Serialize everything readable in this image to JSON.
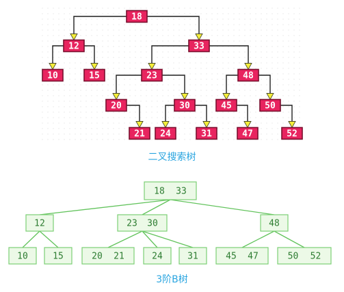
{
  "bst": {
    "caption": "二叉搜索树",
    "nodes": [
      {
        "id": "n18",
        "label": "18"
      },
      {
        "id": "n12",
        "label": "12"
      },
      {
        "id": "n33",
        "label": "33"
      },
      {
        "id": "n10",
        "label": "10"
      },
      {
        "id": "n15",
        "label": "15"
      },
      {
        "id": "n23",
        "label": "23"
      },
      {
        "id": "n48",
        "label": "48"
      },
      {
        "id": "n20",
        "label": "20"
      },
      {
        "id": "n30",
        "label": "30"
      },
      {
        "id": "n45",
        "label": "45"
      },
      {
        "id": "n50",
        "label": "50"
      },
      {
        "id": "n21",
        "label": "21"
      },
      {
        "id": "n24",
        "label": "24"
      },
      {
        "id": "n31",
        "label": "31"
      },
      {
        "id": "n47",
        "label": "47"
      },
      {
        "id": "n52",
        "label": "52"
      }
    ],
    "edges": [
      [
        "n18",
        "n12"
      ],
      [
        "n18",
        "n33"
      ],
      [
        "n12",
        "n10"
      ],
      [
        "n12",
        "n15"
      ],
      [
        "n33",
        "n23"
      ],
      [
        "n33",
        "n48"
      ],
      [
        "n23",
        "n20"
      ],
      [
        "n23",
        "n30"
      ],
      [
        "n48",
        "n45"
      ],
      [
        "n48",
        "n50"
      ],
      [
        "n20",
        "n21"
      ],
      [
        "n30",
        "n24"
      ],
      [
        "n30",
        "n31"
      ],
      [
        "n45",
        "n47"
      ],
      [
        "n50",
        "n52"
      ]
    ]
  },
  "btree": {
    "caption": "3阶B树",
    "nodes": [
      {
        "id": "r",
        "keys": [
          "18",
          "33"
        ]
      },
      {
        "id": "a",
        "keys": [
          "12"
        ]
      },
      {
        "id": "b",
        "keys": [
          "23",
          "30"
        ]
      },
      {
        "id": "c",
        "keys": [
          "48"
        ]
      },
      {
        "id": "l1",
        "keys": [
          "10"
        ]
      },
      {
        "id": "l2",
        "keys": [
          "15"
        ]
      },
      {
        "id": "l3",
        "keys": [
          "20",
          "21"
        ]
      },
      {
        "id": "l4",
        "keys": [
          "24"
        ]
      },
      {
        "id": "l5",
        "keys": [
          "31"
        ]
      },
      {
        "id": "l6",
        "keys": [
          "45",
          "47"
        ]
      },
      {
        "id": "l7",
        "keys": [
          "50",
          "52"
        ]
      }
    ],
    "edges": [
      [
        "r",
        "a"
      ],
      [
        "r",
        "b"
      ],
      [
        "r",
        "c"
      ],
      [
        "a",
        "l1"
      ],
      [
        "a",
        "l2"
      ],
      [
        "b",
        "l3"
      ],
      [
        "b",
        "l4"
      ],
      [
        "b",
        "l5"
      ],
      [
        "c",
        "l6"
      ],
      [
        "c",
        "l7"
      ]
    ]
  }
}
